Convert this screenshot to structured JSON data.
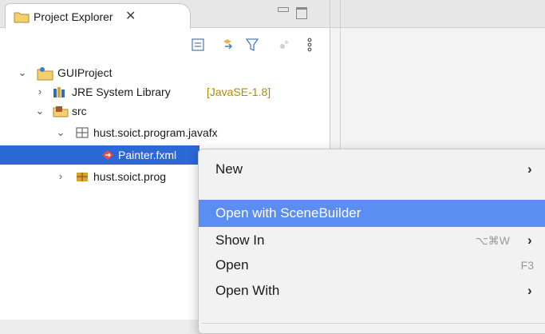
{
  "view": {
    "tab_title": "Project Explorer",
    "tab_close_glyph": "✕",
    "toolbar_icons": [
      "collapse-all-icon",
      "link-with-editor-icon",
      "filter-icon",
      "focus-icon",
      "view-menu-icon"
    ]
  },
  "tree": {
    "project": "GUIProject",
    "jre_label": "JRE System Library",
    "jre_decoration": "[JavaSE-1.8]",
    "src": "src",
    "package1": "hust.soict.program.javafx",
    "file_selected": "Painter.fxml",
    "package2": "hust.soict.prog"
  },
  "context_menu": {
    "items": [
      {
        "label": "New",
        "shortcut": "",
        "submenu": true
      },
      {
        "label": "Open with SceneBuilder",
        "shortcut": "",
        "submenu": false,
        "highlighted": true
      },
      {
        "label": "Show In",
        "shortcut": "⌥⌘W",
        "submenu": true
      },
      {
        "label": "Open",
        "shortcut": "F3",
        "submenu": false
      },
      {
        "label": "Open With",
        "shortcut": "",
        "submenu": true
      }
    ],
    "submenu_glyph": "›"
  },
  "colors": {
    "selection": "#2c68d6",
    "menu_highlight": "#5b8df2",
    "jre_decoration": "#b28a00"
  }
}
